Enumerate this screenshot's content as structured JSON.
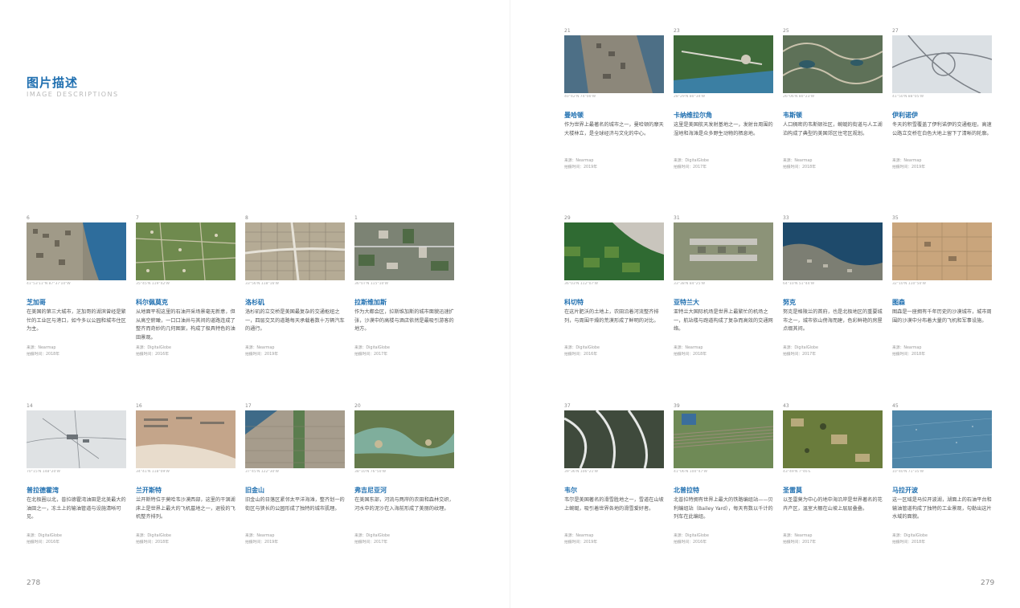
{
  "header": {
    "title": "图片描述",
    "subtitle": "IMAGE DESCRIPTIONS"
  },
  "pages": {
    "left": "278",
    "right": "279"
  },
  "cards": [
    {
      "num": "6",
      "title": "芝加哥",
      "coord": "41°53'11\"N 87°37'10\"W",
      "desc": "在美国的第三大城市，芝加哥的湖滨曾经是繁忙的工业区与港口，如今多以公园和城市住区为主。",
      "meta1": "来源：Nearmap",
      "meta2": "拍摄时间：2018年"
    },
    {
      "num": "7",
      "title": "科尔佩莫克",
      "coord": "35°45'N 119°42'W",
      "desc": "从地面平视这里的石油开采场景毫无新意，但从高空俯瞰，一口口油井与其间的道路连成了整齐而奇妙的几何图案，构成了极具特色的油田景观。",
      "meta1": "来源：DigitalGlobe",
      "meta2": "拍摄时间：2016年"
    },
    {
      "num": "8",
      "title": "洛杉矶",
      "coord": "33°56'N 118°16'W",
      "desc": "洛杉矶的立交桥是美国最复杂的交通枢纽之一，四层交叉的道路每天承载着数十万辆汽车的通行。",
      "meta1": "来源：Nearmap",
      "meta2": "拍摄时间：2019年"
    },
    {
      "num": "1",
      "title": "拉斯维加斯",
      "coord": "36°07'N 115°10'W",
      "desc": "作为大都会区，拉斯维加斯的城市面貌迅速扩张，沙漠中的高楼与酒店依然是最吸引游客的地方。",
      "meta1": "来源：DigitalGlobe",
      "meta2": "拍摄时间：2017年"
    },
    {
      "num": "14",
      "title": "普拉德霍湾",
      "coord": "70°15'N 148°20'W",
      "desc": "在北极圈以北，普拉德霍湾油田是北美最大的油田之一，冻土上的输油管道与设施清晰可见。",
      "meta1": "来源：DigitalGlobe",
      "meta2": "拍摄时间：2016年"
    },
    {
      "num": "16",
      "title": "兰开斯特",
      "coord": "34°41'N 118°09'W",
      "desc": "兰开斯特位于莫哈韦沙漠西部，这里的干涸湖床上是世界上最大的飞机墓地之一，退役的飞机整齐排列。",
      "meta1": "来源：DigitalGlobe",
      "meta2": "拍摄时间：2018年"
    },
    {
      "num": "17",
      "title": "旧金山",
      "coord": "37°45'N 122°30'W",
      "desc": "旧金山的日落区紧邻太平洋海滩，整齐划一的街区与狭长的公园形成了独特的城市肌理。",
      "meta1": "来源：Nearmap",
      "meta2": "拍摄时间：2019年"
    },
    {
      "num": "20",
      "title": "弗吉尼亚河",
      "coord": "38°10'N 76°50'W",
      "desc": "在美国东部，河流与两岸的农田和森林交织，河水中的泥沙在入海前形成了美丽的纹理。",
      "meta1": "来源：DigitalGlobe",
      "meta2": "拍摄时间：2017年"
    },
    {
      "num": "21",
      "title": "曼哈顿",
      "coord": "40°42'N 74°00'W",
      "desc": "作为世界上最著名的城市之一，曼哈顿的摩天大楼林立，是全球经济与文化的中心。",
      "meta1": "来源：Nearmap",
      "meta2": "拍摄时间：2019年"
    },
    {
      "num": "23",
      "title": "卡纳维拉尔角",
      "coord": "28°29'N 80°34'W",
      "desc": "这里是美国航天发射基地之一，发射台周围的湿地和海滩是众多野生动物的栖息地。",
      "meta1": "来源：DigitalGlobe",
      "meta2": "拍摄时间：2017年"
    },
    {
      "num": "25",
      "title": "韦斯顿",
      "coord": "26°06'N 80°23'W",
      "desc": "人口稠密的韦斯顿社区，蜿蜒的街道与人工湖泊构成了典型的美国郊区住宅区规划。",
      "meta1": "来源：Nearmap",
      "meta2": "拍摄时间：2018年"
    },
    {
      "num": "27",
      "title": "伊利诺伊",
      "coord": "41°50'N 88°05'W",
      "desc": "冬天的积雪覆盖了伊利诺伊的交通枢纽，高速公路立交桥在白色大地上留下了清晰的轮廓。",
      "meta1": "来源：Nearmap",
      "meta2": "拍摄时间：2019年"
    },
    {
      "num": "29",
      "title": "科切特",
      "coord": "36°03'N 112°07'W",
      "desc": "在这片肥沃的土地上，农田沿着河流整齐排列，与周围干燥的荒漠形成了鲜明的对比。",
      "meta1": "来源：DigitalGlobe",
      "meta2": "拍摄时间：2016年"
    },
    {
      "num": "31",
      "title": "亚特兰大",
      "coord": "33°38'N 84°25'W",
      "desc": "亚特兰大国际机场是世界上最繁忙的机场之一，航站楼与跑道构成了复杂而高效的交通网络。",
      "meta1": "来源：Nearmap",
      "meta2": "拍摄时间：2018年"
    },
    {
      "num": "33",
      "title": "努克",
      "coord": "64°10'N 51°44'W",
      "desc": "努克是格陵兰的首府，也是北极地区的重要城市之一，城市依山傍海而建，色彩鲜艳的房屋点缀其间。",
      "meta1": "来源：DigitalGlobe",
      "meta2": "拍摄时间：2017年"
    },
    {
      "num": "35",
      "title": "图森",
      "coord": "32°10'N 110°50'W",
      "desc": "图森是一座拥有千年历史的沙漠城市，城市周围的沙漠中分布着大量的飞机和军事设施。",
      "meta1": "来源：Nearmap",
      "meta2": "拍摄时间：2018年"
    },
    {
      "num": "37",
      "title": "韦尔",
      "coord": "39°36'N 106°21'W",
      "desc": "韦尔是美国著名的滑雪胜地之一，雪道在山坡上蜿蜒，吸引着世界各地的滑雪爱好者。",
      "meta1": "来源：Nearmap",
      "meta2": "拍摄时间：2019年"
    },
    {
      "num": "39",
      "title": "北普拉特",
      "coord": "41°06'N 100°47'W",
      "desc": "北普拉特拥有世界上最大的铁路编组站——贝利编组站（Bailey Yard），每天有数以千计的列车在此编组。",
      "meta1": "来源：DigitalGlobe",
      "meta2": "拍摄时间：2016年"
    },
    {
      "num": "43",
      "title": "圣雷莫",
      "coord": "43°49'N 7°46'E",
      "desc": "以圣雷莫为中心的地中海沿岸是世界著名的花卉产区，温室大棚在山坡上层层叠叠。",
      "meta1": "来源：Nearmap",
      "meta2": "拍摄时间：2017年"
    },
    {
      "num": "45",
      "title": "马拉开波",
      "coord": "10°40'N 71°35'W",
      "desc": "这一区域是马拉开波湖，湖面上的石油平台和输油管道构成了独特的工业景观，勾勒出这片水域的面貌。",
      "meta1": "来源：DigitalGlobe",
      "meta2": "拍摄时间：2018年"
    }
  ]
}
